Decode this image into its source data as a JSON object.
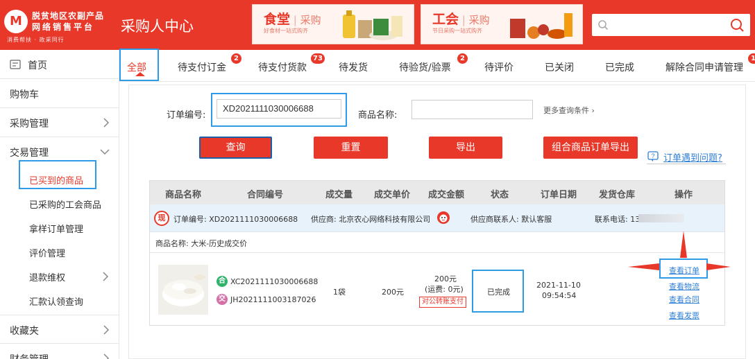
{
  "header": {
    "logo_mark": "M",
    "logo_line1": "脱贫地区农副产品",
    "logo_line2": "网络销售平台",
    "logo_line3": "消费帮扶 · 政采同行",
    "site_title": "采购人中心",
    "banners": [
      {
        "title": "食堂",
        "suffix": "采购",
        "subtitle": "好食材一站式购齐"
      },
      {
        "title": "工会",
        "suffix": "采购",
        "subtitle": "节日采购一站式购齐"
      }
    ],
    "search_placeholder": ""
  },
  "sidebar": {
    "items": [
      {
        "label": "首页",
        "icon": "home-icon"
      },
      {
        "label": "购物车"
      },
      {
        "label": "采购管理",
        "icon": "chevron-right-icon"
      },
      {
        "label": "交易管理",
        "icon": "chevron-down-icon"
      }
    ],
    "sub_items": [
      {
        "label": "已买到的商品",
        "active": true
      },
      {
        "label": "已采购的工会商品"
      },
      {
        "label": "拿样订单管理"
      },
      {
        "label": "评价管理"
      },
      {
        "label": "退款维权",
        "icon": "chevron-right-icon"
      },
      {
        "label": "汇款认领查询"
      }
    ],
    "bottom_items": [
      {
        "label": "收藏夹",
        "icon": "chevron-right-icon"
      },
      {
        "label": "财务管理",
        "icon": "chevron-right-icon"
      }
    ]
  },
  "tabs": [
    {
      "label": "全部",
      "active": true
    },
    {
      "label": "待支付订金",
      "badge": "2"
    },
    {
      "label": "待支付货款",
      "badge": "73"
    },
    {
      "label": "待发货"
    },
    {
      "label": "待验货/验票",
      "badge": "2"
    },
    {
      "label": "待评价"
    },
    {
      "label": "已关闭"
    },
    {
      "label": "已完成"
    },
    {
      "label": "解除合同申请管理",
      "badge": "1"
    }
  ],
  "search_form": {
    "order_no_label": "订单编号:",
    "order_no_value": "XD2021111030006688",
    "product_name_label": "商品名称:",
    "product_name_value": "",
    "more_conditions": "更多查询条件 ›"
  },
  "buttons": {
    "query": "查询",
    "reset": "重置",
    "export": "导出",
    "combo_export": "组合商品订单导出",
    "help": "订单遇到问题?"
  },
  "table": {
    "headers": [
      "商品名称",
      "合同编号",
      "成交量",
      "成交单价",
      "成交金额",
      "状态",
      "订单日期",
      "发货仓库",
      "操作"
    ],
    "order": {
      "tag": "现",
      "order_no": "订单编号: XD2021111030006688",
      "supplier": "供应商: 北京农心网络科技有限公司",
      "contact": "供应商联系人: 默认客服",
      "phone": "联系电话: 13",
      "product_name": "商品名称:  大米-历史成交价",
      "contract_tag_he": "合",
      "contract_no_1": "XC2021111030006688",
      "contract_tag_jiao": "交",
      "contract_no_2": "JH2021111003187026",
      "quantity": "1袋",
      "unit_price": "200元",
      "amount": "200元",
      "shipping": "(运费: 0元)",
      "pay_method": "对公转账支付",
      "status": "已完成",
      "date": "2021-11-10",
      "time": "09:54:54",
      "ops": [
        "查看订单",
        "查看物流",
        "查看合同",
        "查看发票"
      ]
    }
  },
  "colors": {
    "brand_red": "#e8382a",
    "highlight_blue": "#2e9be8",
    "link_blue": "#2e7fd6",
    "table_head_bg": "#e9e9e9",
    "order_row_bg": "#e8f2fb"
  }
}
